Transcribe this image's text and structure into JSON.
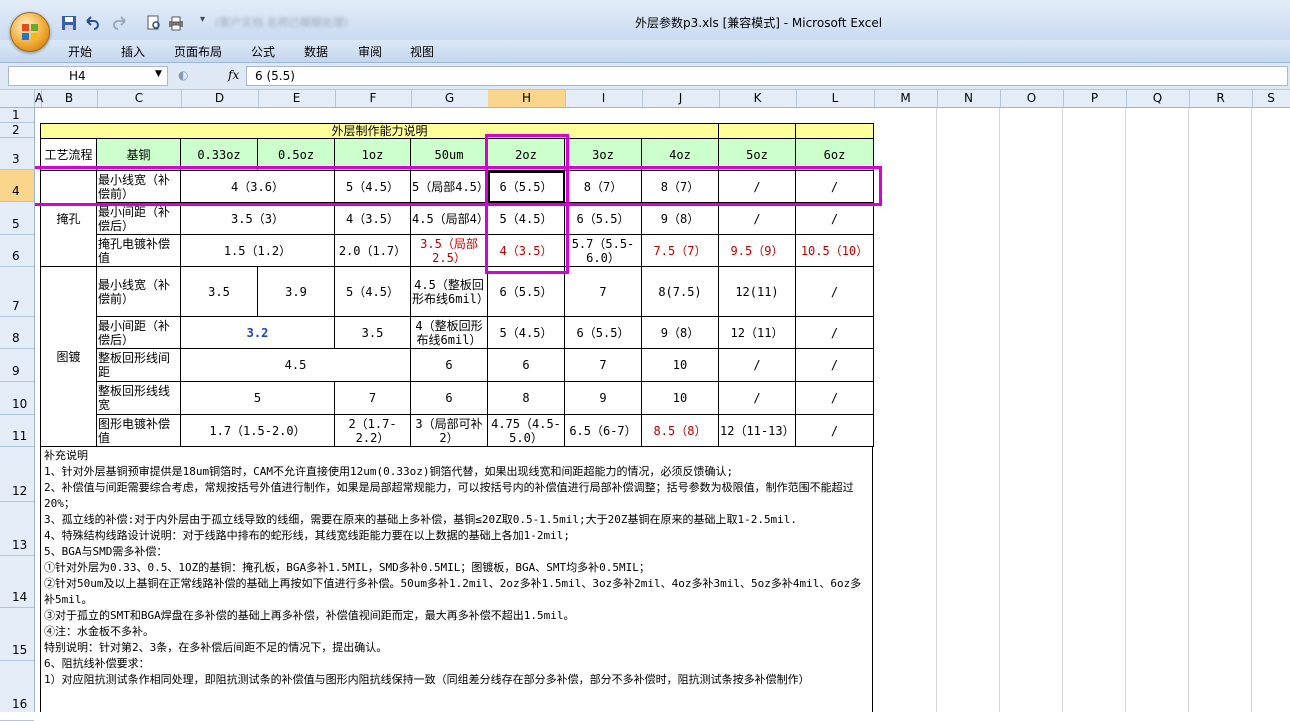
{
  "app": {
    "title": "外层参数p3.xls  [兼容模式] - Microsoft Excel",
    "blurred_title": "(客户文档 名称已模糊处理)",
    "tabs": [
      "开始",
      "插入",
      "页面布局",
      "公式",
      "数据",
      "审阅",
      "视图"
    ]
  },
  "formula_bar": {
    "name_box": "H4",
    "fx": "fx",
    "formula": "6 (5.5)"
  },
  "columns": [
    "A",
    "B",
    "C",
    "D",
    "E",
    "F",
    "G",
    "H",
    "I",
    "J",
    "K",
    "L",
    "M",
    "N",
    "O",
    "P",
    "Q",
    "R",
    "S"
  ],
  "rows": [
    "1",
    "2",
    "3",
    "4",
    "5",
    "6",
    "7",
    "8",
    "9",
    "10",
    "11",
    "12",
    "13",
    "14",
    "15",
    "16"
  ],
  "table": {
    "title": "外层制作能力说明",
    "header": [
      "工艺流程",
      "基铜",
      "0.33oz",
      "0.5oz",
      "1oz",
      "50um",
      "2oz",
      "3oz",
      "4oz",
      "5oz",
      "6oz"
    ],
    "group1": "掩孔",
    "group2": "图镀",
    "r4": [
      "最小线宽（补偿前）",
      "4（3.6）",
      "5（4.5）",
      "5（局部4.5）",
      "6（5.5）",
      "8（7）",
      "8（7）",
      "/",
      "/"
    ],
    "r5": [
      "最小间距（补偿后）",
      "3.5（3）",
      "4（3.5）",
      "4.5（局部4）",
      "5（4.5）",
      "6（5.5）",
      "9（8）",
      "/",
      "/"
    ],
    "r6": [
      "掩孔电镀补偿值",
      "1.5（1.2）",
      "2.0（1.7）",
      "3.5（局部2.5）",
      "4（3.5）",
      "5.7（5.5-6.0）",
      "7.5（7）",
      "9.5（9）",
      "10.5（10）"
    ],
    "r7": [
      "最小线宽（补偿前）",
      "3.5",
      "3.9",
      "5（4.5）",
      "4.5（整板回形布线6mil）",
      "6（5.5）",
      "7",
      "8(7.5)",
      "12(11)",
      "/"
    ],
    "r8": [
      "最小间距（补偿后）",
      "3.2",
      "3.5",
      "4（整板回形布线6mil）",
      "5（4.5）",
      "6（5.5）",
      "9（8）",
      "12（11）",
      "/"
    ],
    "r9": [
      "整板回形线间距",
      "4.5",
      "6",
      "6",
      "7",
      "10",
      "/",
      "/"
    ],
    "r10": [
      "整板回形线线宽",
      "5",
      "7",
      "6",
      "8",
      "9",
      "10",
      "/",
      "/"
    ],
    "r11": [
      "图形电镀补偿值",
      "1.7（1.5-2.0）",
      "2（1.7-2.2）",
      "3（局部可补2）",
      "4.75（4.5-5.0）",
      "6.5（6-7）",
      "8.5（8）",
      "12（11-13）",
      "/"
    ]
  },
  "notes": [
    "补充说明",
    "1、针对外层基铜预审提供是18um铜箔时，CAM不允许直接使用12um(0.33oz)铜箔代替，如果出现线宽和间距超能力的情况，必须反馈确认;",
    "2、补偿值与间距需要综合考虑，常规按括号外值进行制作，如果是局部超常规能力，可以按括号内的补偿值进行局部补偿调整；括号参数为极限值，制作范围不能超过20%；",
    "3、孤立线的补偿:对于内外层由于孤立线导致的线细，需要在原来的基础上多补偿，基铜≤20Z取0.5-1.5mil;大于20Z基铜在原来的基础上取1-2.5mil.",
    "4、特殊结构线路设计说明：对于线路中排布的蛇形线，其线宽线距能力要在以上数据的基础上各加1-2mil;",
    "5、BGA与SMD需多补偿：",
    "①针对外层为0.33、0.5、1OZ的基铜：掩孔板，BGA多补1.5MIL，SMD多补0.5MIL；图镀板，BGA、SMT均多补0.5MIL；",
    "②针对50um及以上基铜在正常线路补偿的基础上再按如下值进行多补偿。50um多补1.2mil、2oz多补1.5mil、3oz多补2mil、4oz多补3mil、5oz多补4mil、6oz多补5mil。",
    "③对于孤立的SMT和BGA焊盘在多补偿的基础上再多补偿，补偿值视间距而定，最大再多补偿不超出1.5mil。",
    "④注：水金板不多补。",
    "特别说明：针对第2、3条，在多补偿后间距不足的情况下，提出确认。",
    "6、阻抗线补偿要求：",
    "1）对应阻抗测试条作相同处理，即阻抗测试条的补偿值与图形内阻抗线保持一致（同组差分线存在部分多补偿，部分不多补偿时，阻抗测试条按多补偿制作）"
  ],
  "colors": {
    "highlight": "#d800d8",
    "yellow": "#ffff99",
    "green": "#ccffcc",
    "red_text": "#c00000",
    "selected_header": "#f8d58a"
  }
}
